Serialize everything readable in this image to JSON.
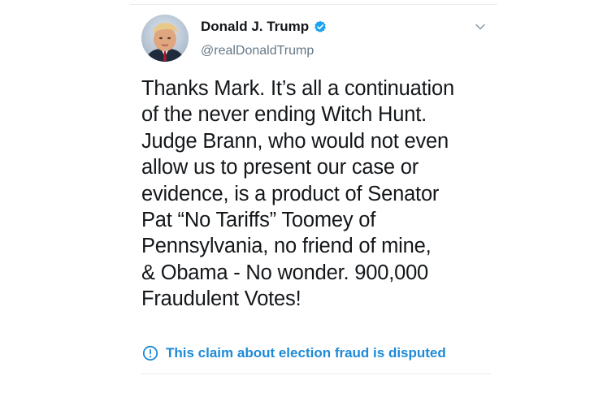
{
  "tweet": {
    "author": {
      "display_name": "Donald J. Trump",
      "handle": "@realDonaldTrump",
      "verified": true,
      "avatar_icon": "profile-photo"
    },
    "menu_icon": "chevron-down-icon",
    "text_lines": [
      "Thanks Mark. It’s all a continuation",
      "of the never ending Witch Hunt.",
      "Judge Brann, who would not even",
      "allow us to present our case or",
      "evidence, is a product of Senator",
      "Pat “No Tariffs” Toomey of",
      "Pennsylvania, no friend of mine,",
      "& Obama - No wonder. 900,000",
      "Fraudulent Votes!"
    ],
    "label": {
      "icon": "info-circle-icon",
      "text": "This claim about election fraud is disputed"
    }
  },
  "colors": {
    "text_primary": "#14171a",
    "text_secondary": "#657786",
    "accent_blue": "#1d8ad8",
    "verified_blue": "#1da1f2",
    "divider": "#e6ecf0"
  }
}
